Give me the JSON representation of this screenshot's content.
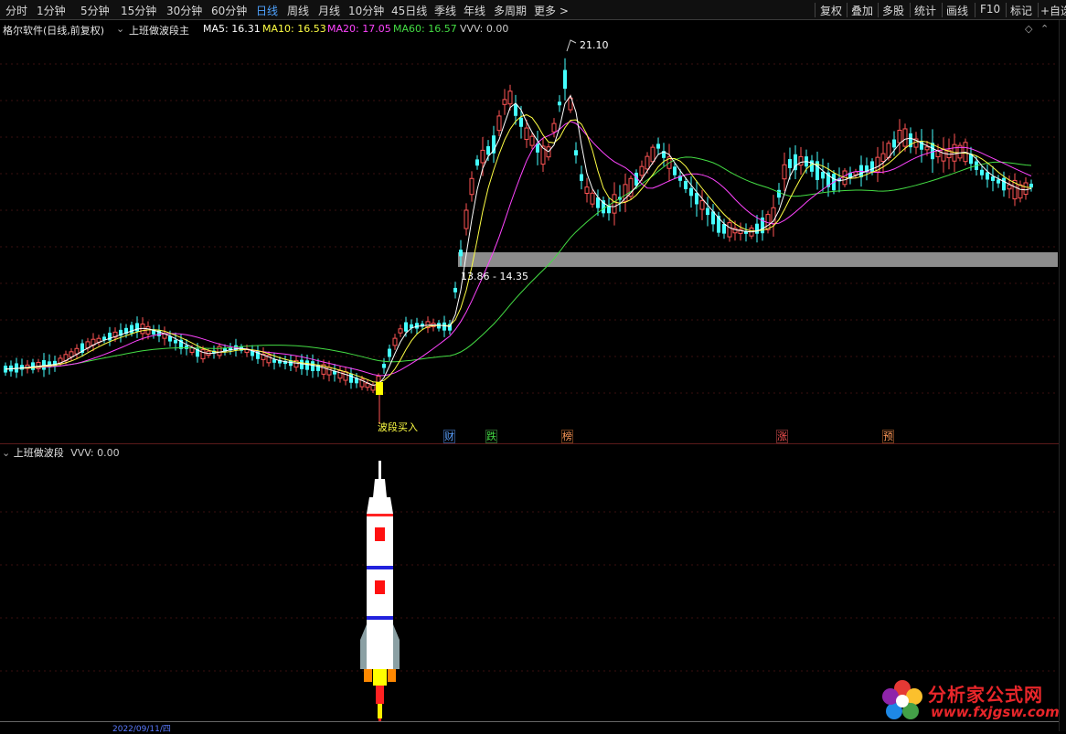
{
  "toolbar": {
    "periods": [
      "分时",
      "1分钟",
      "5分钟",
      "15分钟",
      "30分钟",
      "60分钟",
      "日线",
      "周线",
      "月线",
      "10分钟",
      "45日线",
      "季线",
      "年线",
      "多周期",
      "更多 >"
    ],
    "active_period": "日线",
    "right_buttons": [
      "复权",
      "叠加",
      "多股",
      "统计",
      "画线",
      "F10",
      "标记",
      "+自选"
    ]
  },
  "main_panel": {
    "title": "格尔软件(日线,前复权)",
    "indicator": "上班做波段主",
    "ma5": "MA5: 16.31",
    "ma10": "MA10: 16.53",
    "ma20": "MA20: 17.05",
    "ma60": "MA60: 16.57",
    "vvv": "VVV: 0.00",
    "high_label": "21.10",
    "zone_label": "13.86 - 14.35",
    "buy_label": "波段买入",
    "colors": {
      "ma5": "#ffffff",
      "ma10": "#ffff44",
      "ma20": "#ff44ff",
      "ma60": "#44dd44",
      "up": "#ff5555",
      "down": "#44ffff",
      "zone": "#8c8c8c"
    }
  },
  "events": [
    {
      "label": "财",
      "color": "#5aa0ff"
    },
    {
      "label": "跌",
      "color": "#44dd44"
    },
    {
      "label": "榜",
      "color": "#ff9a5a"
    },
    {
      "label": "涨",
      "color": "#ff5555"
    },
    {
      "label": "预",
      "color": "#ff9a5a"
    }
  ],
  "sub_panel": {
    "indicator": "上班做波段",
    "vvv": "VVV: 0.00"
  },
  "bottom_axis": {
    "date_label": "2022/09/11/四"
  },
  "watermark": {
    "cn": "分析家公式网",
    "url": "www.fxjgsw.com"
  }
}
